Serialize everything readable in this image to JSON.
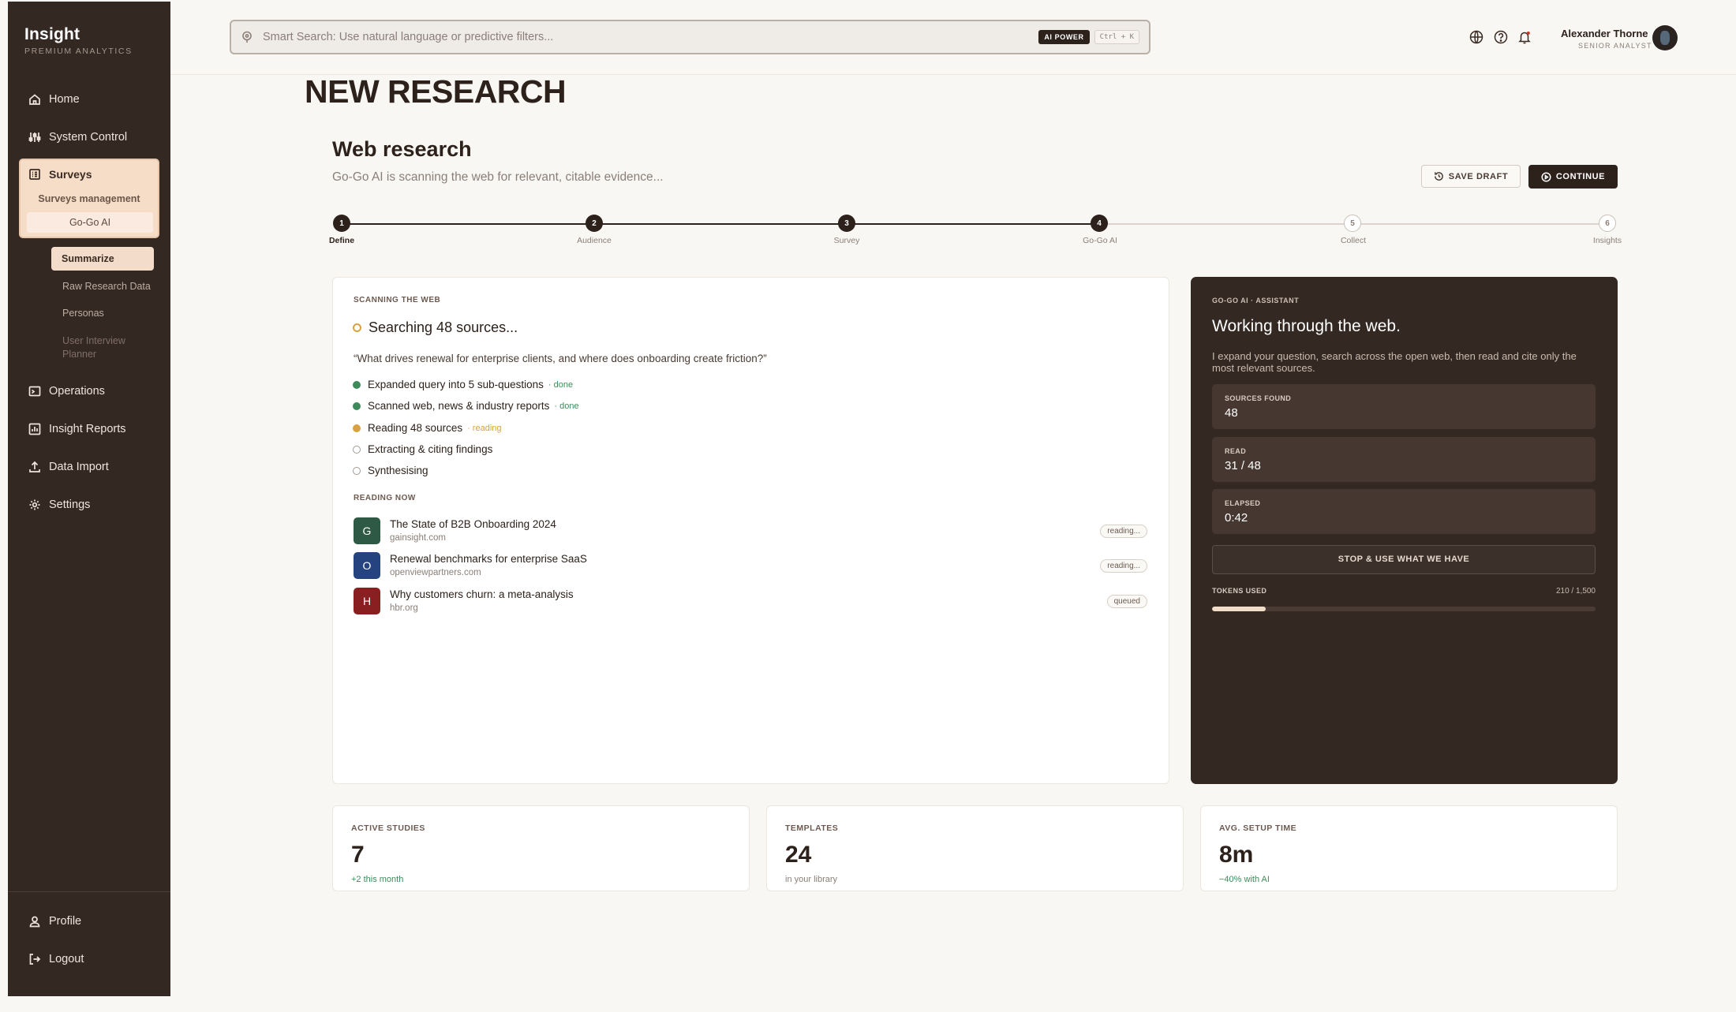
{
  "brand": {
    "name": "Insight",
    "subtitle": "PREMIUM ANALYTICS"
  },
  "nav": {
    "home": "Home",
    "system_control": "System Control",
    "surveys": "Surveys",
    "surveys_management": "Surveys management",
    "gogo_ai": "Go-Go AI",
    "summarize": "Summarize",
    "raw_research": "Raw Research Data",
    "personas": "Personas",
    "interview_planner": "User Interview Planner",
    "operations": "Operations",
    "insight_reports": "Insight Reports",
    "data_import": "Data Import",
    "settings": "Settings",
    "profile": "Profile",
    "logout": "Logout"
  },
  "search": {
    "placeholder": "Smart Search: Use natural language or predictive filters...",
    "badge": "AI POWER",
    "shortcut": "Ctrl + K"
  },
  "user": {
    "name": "Alexander Thorne",
    "role": "SENIOR ANALYST"
  },
  "page": {
    "title": "NEW RESEARCH",
    "section_title": "Web research",
    "section_subtitle": "Go-Go AI is scanning the web for relevant, citable evidence...",
    "save_draft": "SAVE DRAFT",
    "continue": "CONTINUE"
  },
  "steps": [
    {
      "num": "1",
      "label": "Define",
      "done": true
    },
    {
      "num": "2",
      "label": "Audience",
      "done": true
    },
    {
      "num": "3",
      "label": "Survey",
      "done": true
    },
    {
      "num": "4",
      "label": "Go-Go AI",
      "done": true
    },
    {
      "num": "5",
      "label": "Collect",
      "done": false
    },
    {
      "num": "6",
      "label": "Insights",
      "done": false
    }
  ],
  "scan": {
    "kicker": "SCANNING THE WEB",
    "heading": "Searching 48 sources...",
    "question": "“What drives renewal for enterprise clients, and where does onboarding create friction?”",
    "tasks": [
      {
        "label": "Expanded query into 5 sub-questions",
        "status": "· done",
        "state": "green"
      },
      {
        "label": "Scanned web, news & industry reports",
        "status": "· done",
        "state": "green"
      },
      {
        "label": "Reading 48 sources",
        "status": "· reading",
        "state": "amber"
      },
      {
        "label": "Extracting & citing findings",
        "status": "",
        "state": "empty"
      },
      {
        "label": "Synthesising",
        "status": "",
        "state": "empty"
      }
    ],
    "reading_kicker": "READING NOW",
    "sources": [
      {
        "letter": "G",
        "title": "The State of B2B Onboarding 2024",
        "domain": "gainsight.com",
        "status": "reading...",
        "color": "#2e5a45"
      },
      {
        "letter": "O",
        "title": "Renewal benchmarks for enterprise SaaS",
        "domain": "openviewpartners.com",
        "status": "reading...",
        "color": "#24437f"
      },
      {
        "letter": "H",
        "title": "Why customers churn: a meta-analysis",
        "domain": "hbr.org",
        "status": "queued",
        "color": "#8a1f22"
      }
    ]
  },
  "assistant": {
    "kicker": "GO-GO AI · ASSISTANT",
    "title": "Working through the web.",
    "description": "I expand your question, search across the open web, then read and cite only the most relevant sources.",
    "metrics": [
      {
        "label": "SOURCES FOUND",
        "value": "48"
      },
      {
        "label": "READ",
        "value": "31 / 48"
      },
      {
        "label": "ELAPSED",
        "value": "0:42"
      }
    ],
    "stop_button": "STOP & USE WHAT WE HAVE",
    "tokens_label": "TOKENS USED",
    "tokens_count": "210 / 1,500",
    "tokens_fraction": 0.14
  },
  "stats": [
    {
      "label": "ACTIVE STUDIES",
      "value": "7",
      "note": "+2 this month",
      "note_green": true
    },
    {
      "label": "TEMPLATES",
      "value": "24",
      "note": "in your library",
      "note_green": false
    },
    {
      "label": "AVG. SETUP TIME",
      "value": "8m",
      "note": "−40% with AI",
      "note_green": true
    }
  ]
}
